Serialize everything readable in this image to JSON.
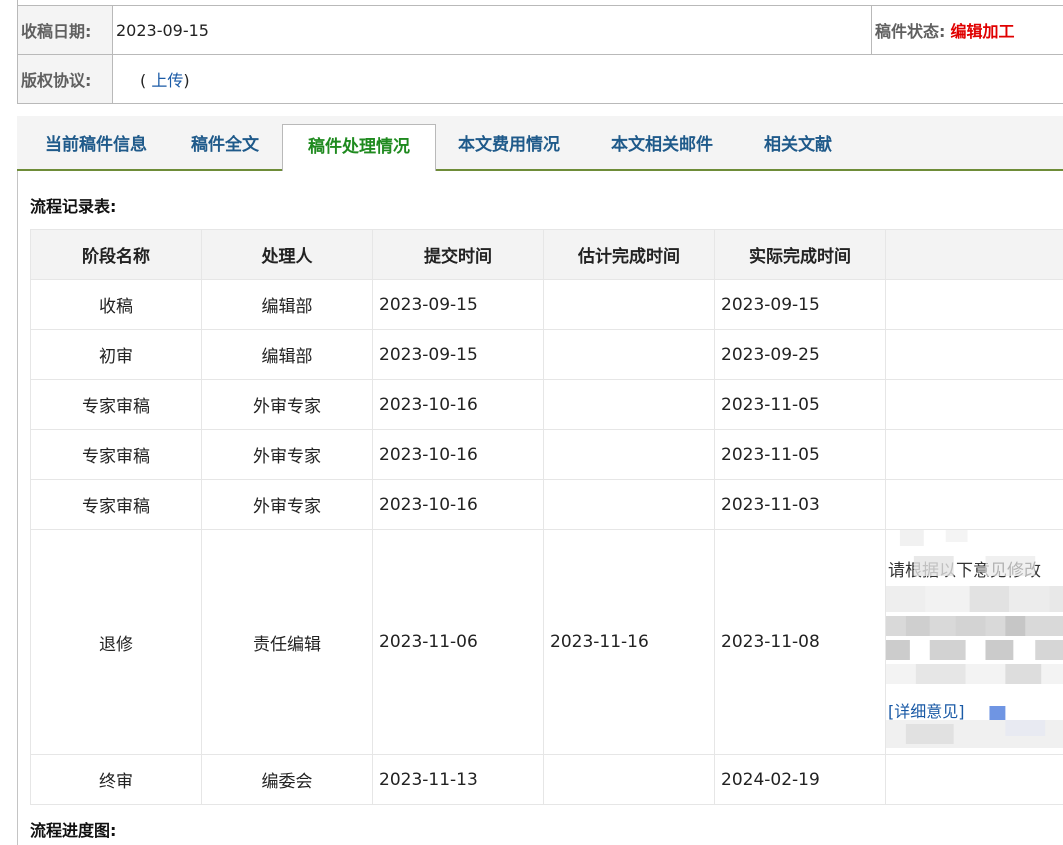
{
  "info": {
    "received_label": "收稿日期:",
    "received_value": "2023-09-15",
    "status_label": "稿件状态:",
    "status_value": "编辑加工",
    "copyright_label": "版权协议:",
    "copyright_open": "(",
    "copyright_link": "上传",
    "copyright_close": ")"
  },
  "tabs": [
    {
      "label": "当前稿件信息",
      "active": false
    },
    {
      "label": "稿件全文",
      "active": false
    },
    {
      "label": "稿件处理情况",
      "active": true
    },
    {
      "label": "本文费用情况",
      "active": false
    },
    {
      "label": "本文相关邮件",
      "active": false
    },
    {
      "label": "相关文献",
      "active": false
    }
  ],
  "flow": {
    "title": "流程记录表:",
    "headers": [
      "阶段名称",
      "处理人",
      "提交时间",
      "估计完成时间",
      "实际完成时间",
      ""
    ],
    "rows": [
      {
        "stage": "收稿",
        "handler": "编辑部",
        "submitted": "2023-09-15",
        "estimated": "",
        "actual": "2023-09-15"
      },
      {
        "stage": "初审",
        "handler": "编辑部",
        "submitted": "2023-09-15",
        "estimated": "",
        "actual": "2023-09-25"
      },
      {
        "stage": "专家审稿",
        "handler": "外审专家",
        "submitted": "2023-10-16",
        "estimated": "",
        "actual": "2023-11-05"
      },
      {
        "stage": "专家审稿",
        "handler": "外审专家",
        "submitted": "2023-10-16",
        "estimated": "",
        "actual": "2023-11-05"
      },
      {
        "stage": "专家审稿",
        "handler": "外审专家",
        "submitted": "2023-10-16",
        "estimated": "",
        "actual": "2023-11-03"
      },
      {
        "stage": "退修",
        "handler": "责任编辑",
        "submitted": "2023-11-06",
        "estimated": "2023-11-16",
        "actual": "2023-11-08"
      },
      {
        "stage": "终审",
        "handler": "编委会",
        "submitted": "2023-11-13",
        "estimated": "",
        "actual": "2024-02-19"
      }
    ],
    "revision_note": "请根据以下意见修改",
    "revision_detail_link": "[详细意见]"
  },
  "progress": {
    "title": "流程进度图:"
  }
}
